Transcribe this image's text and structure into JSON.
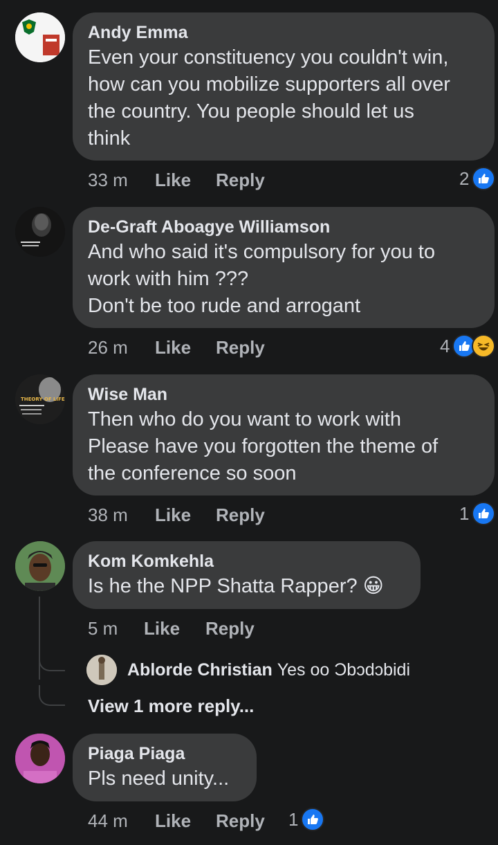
{
  "comments": [
    {
      "author": "Andy Emma",
      "text": "Even your constituency you couldn't win,\nhow can you mobilize supporters all over\nthe country. You people should let us\nthink",
      "time": "33 m",
      "like_label": "Like",
      "reply_label": "Reply",
      "reaction_count": "2"
    },
    {
      "author": "De-Graft Aboagye Williamson",
      "text": "And who said it's compulsory for you to\nwork with him ???\nDon't be too rude and arrogant",
      "time": "26 m",
      "like_label": "Like",
      "reply_label": "Reply",
      "reaction_count": "4"
    },
    {
      "author": "Wise Man",
      "text": "Then who do you want to work with\nPlease have you forgotten the theme of\nthe conference so soon",
      "time": "38 m",
      "like_label": "Like",
      "reply_label": "Reply",
      "reaction_count": "1",
      "avatar_text": "THEORY OF LIFE"
    },
    {
      "author": "Kom Komkehla",
      "text": "Is he the NPP Shatta Rapper? 😀",
      "time": "5 m",
      "like_label": "Like",
      "reply_label": "Reply"
    },
    {
      "author": "Piaga Piaga",
      "text": "Pls need unity...",
      "time": "44 m",
      "like_label": "Like",
      "reply_label": "Reply",
      "reaction_count": "1"
    }
  ],
  "reply_preview": {
    "author": "Ablorde Christian",
    "text": "Yes oo Ɔbɔdɔbidi"
  },
  "view_more": "View 1 more reply...",
  "colors": {
    "background": "#18191a",
    "bubble": "#3a3b3c",
    "like_blue": "#1877f2",
    "meta_text": "#b0b3b8"
  }
}
